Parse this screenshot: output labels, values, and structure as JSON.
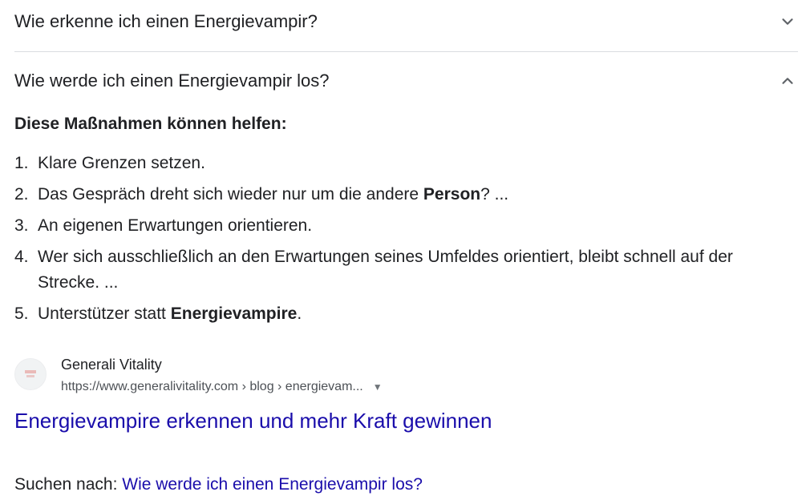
{
  "faq": {
    "question_1": "Wie erkenne ich einen Energievampir?",
    "question_2": "Wie werde ich einen Energievampir los?",
    "expand_icon": "chevron-down-icon",
    "collapse_icon": "chevron-up-icon"
  },
  "answer": {
    "heading": "Diese Maßnahmen können helfen:",
    "steps": [
      {
        "num": "1.",
        "pre": "Klare Grenzen setzen.",
        "bold": "",
        "post": ""
      },
      {
        "num": "2.",
        "pre": "Das Gespräch dreht sich wieder nur um die andere ",
        "bold": "Person",
        "post": "? ..."
      },
      {
        "num": "3.",
        "pre": "An eigenen Erwartungen orientieren.",
        "bold": "",
        "post": ""
      },
      {
        "num": "4.",
        "pre": "Wer sich ausschließlich an den Erwartungen seines Umfeldes orientiert, bleibt schnell auf der Strecke. ...",
        "bold": "",
        "post": ""
      },
      {
        "num": "5.",
        "pre": "Unterstützer statt ",
        "bold": "Energievampire",
        "post": "."
      }
    ]
  },
  "source": {
    "site_name": "Generali Vitality",
    "url": "https://www.generalivitality.com › blog › energievam...",
    "favicon_icon": "generali-favicon-icon",
    "menu_icon": "caret-down-icon"
  },
  "result": {
    "title": "Energievampire erkennen und mehr Kraft gewinnen"
  },
  "search_for": {
    "label": "Suchen nach: ",
    "query": "Wie werde ich einen Energievampir los?"
  },
  "colors": {
    "link": "#1a0dab",
    "text": "#202124",
    "url": "#4d5156",
    "divider": "#dadce0"
  }
}
